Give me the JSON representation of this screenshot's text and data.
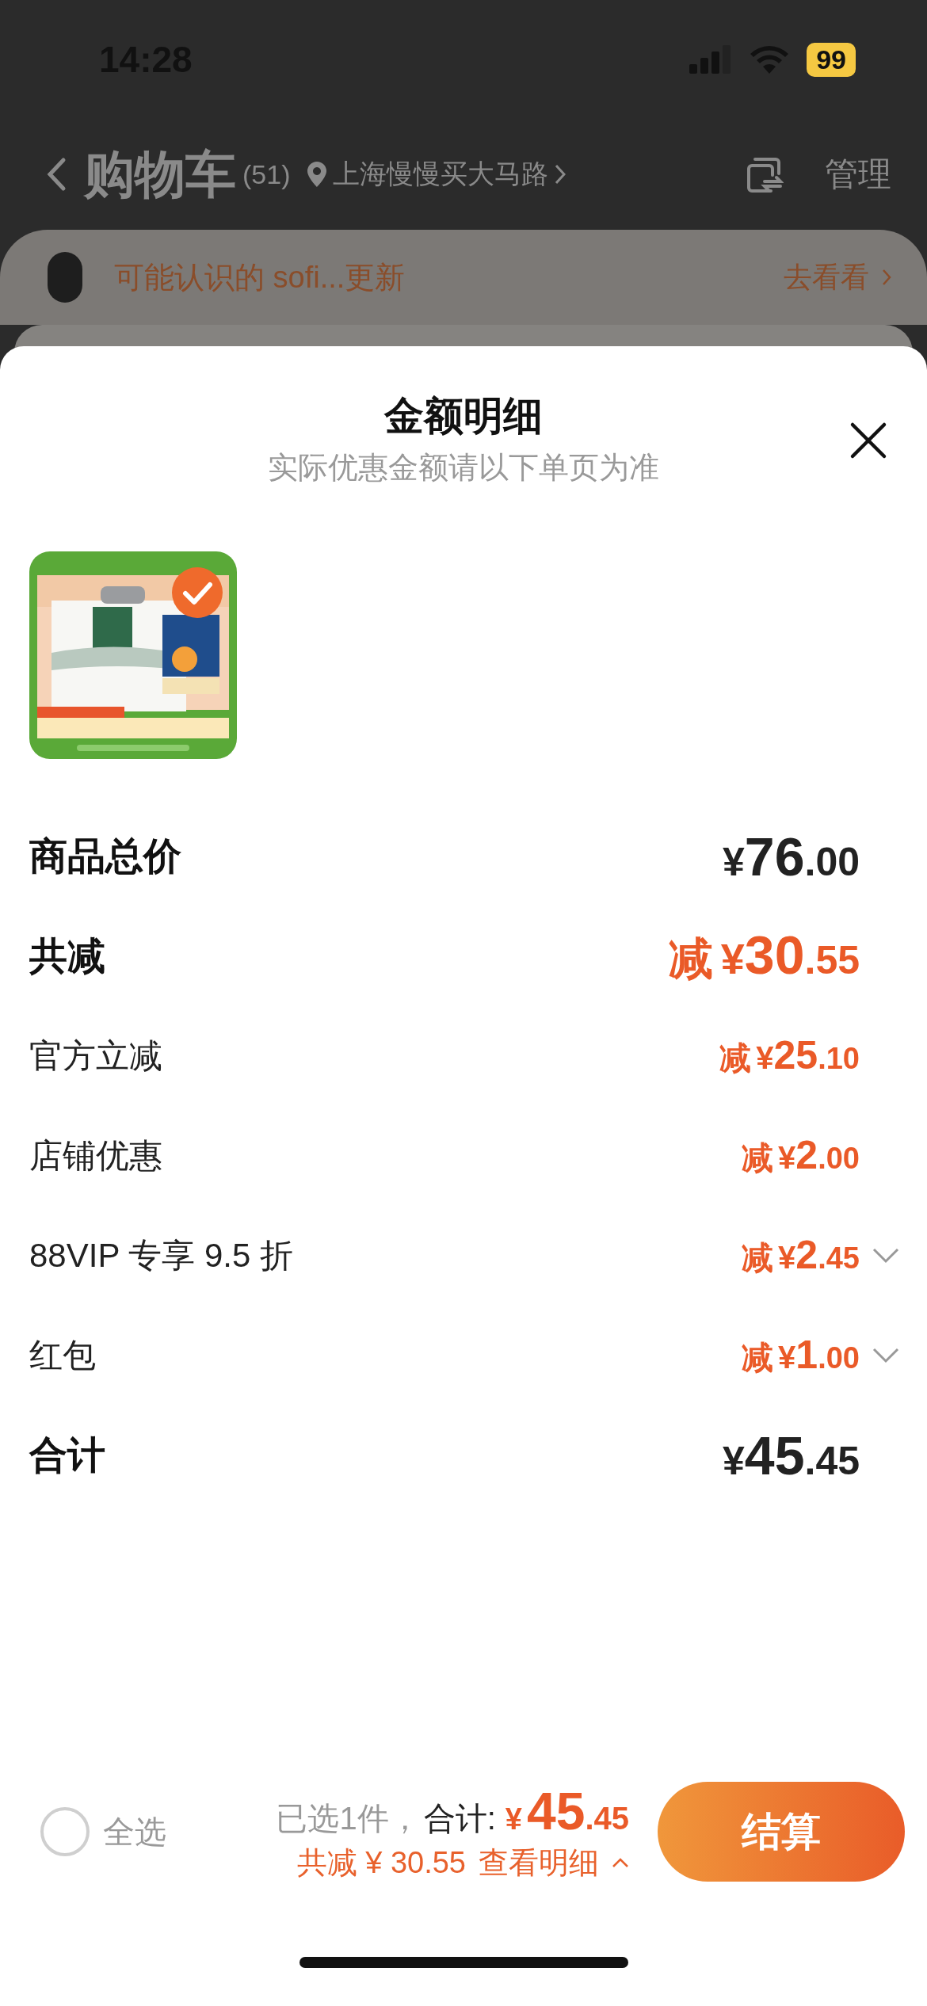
{
  "status_bar": {
    "time": "14:28",
    "battery": "99"
  },
  "header": {
    "title": "购物车",
    "count": "(51)",
    "location": "上海慢慢买大马路",
    "manage": "管理"
  },
  "notice": {
    "text": "可能认识的 sofi...更新",
    "action": "去看看"
  },
  "sheet": {
    "title": "金额明细",
    "subtitle": "实际优惠金额请以下单页为准",
    "items": [
      {
        "kind": "picture",
        "selected": true
      }
    ],
    "rows": [
      {
        "kind": "major",
        "label": "商品总价",
        "currency": "¥",
        "integer": "76",
        "decimal": ".00",
        "expandable": false
      },
      {
        "kind": "discount_total",
        "label": "共减",
        "prefix": "减",
        "currency": "¥",
        "integer": "30",
        "decimal": ".55",
        "expandable": false
      },
      {
        "kind": "discount",
        "label": "官方立减",
        "prefix": "减",
        "currency": "¥",
        "integer": "25",
        "decimal": ".10",
        "expandable": false
      },
      {
        "kind": "discount",
        "label": "店铺优惠",
        "prefix": "减",
        "currency": "¥",
        "integer": "2",
        "decimal": ".00",
        "expandable": false
      },
      {
        "kind": "discount",
        "label": "88VIP 专享 9.5 折",
        "prefix": "减",
        "currency": "¥",
        "integer": "2",
        "decimal": ".45",
        "expandable": true
      },
      {
        "kind": "discount",
        "label": "红包",
        "prefix": "减",
        "currency": "¥",
        "integer": "1",
        "decimal": ".00",
        "expandable": true
      },
      {
        "kind": "major",
        "label": "合计",
        "currency": "¥",
        "integer": "45",
        "decimal": ".45",
        "expandable": false
      }
    ]
  },
  "footer": {
    "select_all": {
      "label": "全选",
      "checked": false
    },
    "selected_count": "已选1件，",
    "total_label": "合计:",
    "currency": "¥",
    "integer": "45",
    "decimal": ".45",
    "saving": "共减 ¥ 30.55",
    "details_link": "查看明细",
    "checkout": "结算"
  }
}
